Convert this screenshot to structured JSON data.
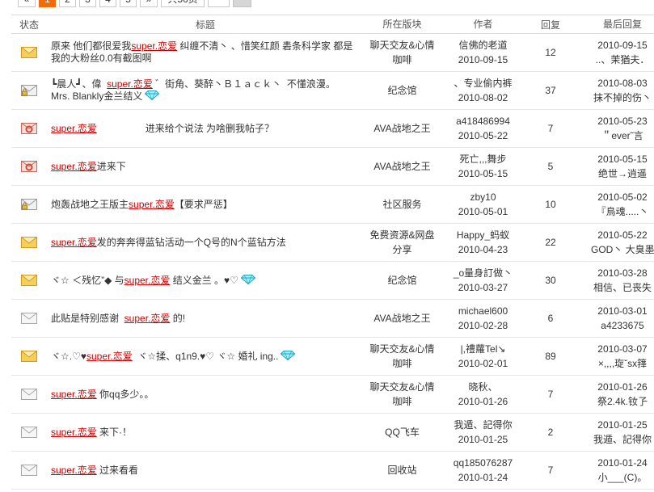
{
  "colors": {
    "keyword": "#cc0000",
    "active_page": "#f26b0a",
    "text": "#333333",
    "row_line": "#e6e6e6"
  },
  "pagination": {
    "prev": "«",
    "pages": [
      {
        "label": "1",
        "active": true
      },
      {
        "label": "2",
        "active": false
      },
      {
        "label": "3",
        "active": false
      },
      {
        "label": "4",
        "active": false
      },
      {
        "label": "5",
        "active": false
      }
    ],
    "next": "»",
    "total": "共56页"
  },
  "header": {
    "status": "状态",
    "title": "标题",
    "section": "所在版块",
    "author": "作者",
    "replies": "回复",
    "last_reply": "最后回复"
  },
  "threads": [
    {
      "icon": "hot-envelope-icon",
      "title": [
        {
          "text": "原来 他们都很爱我"
        },
        {
          "text": "super.恋爱",
          "highlight": true
        },
        {
          "text": " 纠缠不清丶 、惜笑红颜 砉条科学家 都是我的大粉丝0.0有截图啊"
        }
      ],
      "section": "聊天交友&心情咖啡",
      "author": "信佛的老道",
      "date": "2010-09-15",
      "replies": 12,
      "last_date": "2010-09-15",
      "last_author": "..、茉猶夫．"
    },
    {
      "icon": "locked-envelope-icon",
      "title": [
        {
          "text": "┗晨人┛、偉  "
        },
        {
          "text": "super.恋爱",
          "highlight": true
        },
        {
          "text": " ゛街角、葵醉丶Ｂ１ａｃｋ丶  不懂浪漫。  Mrs. Blankly金兰结义"
        }
      ],
      "badge": "diamond-icon",
      "section": "纪念馆",
      "author": "、专业偷内裤",
      "date": "2010-08-02",
      "replies": 37,
      "last_date": "2010-08-03",
      "last_author": "抹不掉的伤丶"
    },
    {
      "icon": "red-envelope-icon",
      "title": [
        {
          "text": "super.恋爱",
          "highlight": true
        },
        {
          "text": "　　　　　进来给个说法 为啥删我帖子？"
        }
      ],
      "section": "AVA战地之王",
      "author": "a418486994",
      "date": "2010-05-22",
      "replies": 7,
      "last_date": "2010-05-23",
      "last_author": "＂ever˜言"
    },
    {
      "icon": "red-envelope-icon",
      "title": [
        {
          "text": "super.恋爱",
          "highlight": true
        },
        {
          "text": "进来下"
        }
      ],
      "section": "AVA战地之王",
      "author": "死亡,,,舞步",
      "date": "2010-05-15",
      "replies": 5,
      "last_date": "2010-05-15",
      "last_author": "绝世→逍遥"
    },
    {
      "icon": "locked-envelope-icon",
      "title": [
        {
          "text": "炮轰战地之王版主"
        },
        {
          "text": "super.恋爱",
          "highlight": true
        },
        {
          "text": "【要求严惩】"
        }
      ],
      "section": "社区服务",
      "author": "zby10",
      "date": "2010-05-01",
      "replies": 10,
      "last_date": "2010-05-02",
      "last_author": "『鳥魂.....丶"
    },
    {
      "icon": "hot-envelope-icon",
      "title": [
        {
          "text": "super.恋爱",
          "highlight": true
        },
        {
          "text": "发的奔奔得蓝钻活动一个Q号的N个蓝钻方法"
        }
      ],
      "section": "免费资源&网盘分享",
      "author": "Happy_蚂蚁",
      "date": "2010-04-23",
      "replies": 22,
      "last_date": "2010-05-22",
      "last_author": "GOD丶 大臭墨"
    },
    {
      "icon": "hot-envelope-icon",
      "title": [
        {
          "text": "ヾ☆ ＜残忆”◆ 与"
        },
        {
          "text": "super.恋爱",
          "highlight": true
        },
        {
          "text": " 结义金兰 。♥♡"
        }
      ],
      "badge": "diamond-icon",
      "section": "纪念馆",
      "author": "_o量身訂做丶",
      "date": "2010-03-27",
      "replies": 30,
      "last_date": "2010-03-28",
      "last_author": "相信、已丧失"
    },
    {
      "icon": "envelope-icon",
      "title": [
        {
          "text": "此贴是特别感谢  "
        },
        {
          "text": "super.恋爱",
          "highlight": true
        },
        {
          "text": " 的!"
        }
      ],
      "section": "AVA战地之王",
      "author": "michael600",
      "date": "2010-02-28",
      "replies": 6,
      "last_date": "2010-03-01",
      "last_author": "a4233675"
    },
    {
      "icon": "hot-envelope-icon",
      "title": [
        {
          "text": "ヾ☆.♡♥"
        },
        {
          "text": "super.恋爱",
          "highlight": true
        },
        {
          "text": "  ヾ☆揉、q1n9.♥♡ ヾ☆ 婚礼 ing.."
        }
      ],
      "badge": "diamond-icon",
      "section": "聊天交友&心情咖啡",
      "author": "|,禮蘿Tel↘",
      "date": "2010-02-01",
      "replies": 89,
      "last_date": "2010-03-07",
      "last_author": "×,,,,琁ˇsx箨"
    },
    {
      "icon": "envelope-icon",
      "title": [
        {
          "text": "super.恋爱",
          "highlight": true
        },
        {
          "text": " 你qq多少。。"
        }
      ],
      "section": "聊天交友&心情咖啡",
      "author": "晓秋、",
      "date": "2010-01-26",
      "replies": 7,
      "last_date": "2010-01-26",
      "last_author": "祭2.4k.钕孒"
    },
    {
      "icon": "envelope-icon",
      "title": [
        {
          "text": "super.恋爱",
          "highlight": true
        },
        {
          "text": " 来下·！"
        }
      ],
      "section": "QQ飞车",
      "author": "我遁、記得你",
      "date": "2010-01-25",
      "replies": 2,
      "last_date": "2010-01-25",
      "last_author": "我遁、記得你"
    },
    {
      "icon": "envelope-icon",
      "title": [
        {
          "text": "super.恋爱",
          "highlight": true
        },
        {
          "text": " 过来看看"
        }
      ],
      "section": "回收站",
      "author": "qq185076287",
      "date": "2010-01-24",
      "replies": 7,
      "last_date": "2010-01-24",
      "last_author": "小___(C)。"
    }
  ]
}
